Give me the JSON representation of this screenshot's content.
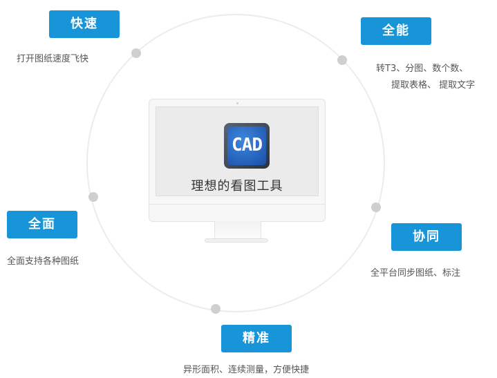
{
  "logo": {
    "text": "CAD"
  },
  "center": {
    "title": "理想的看图工具"
  },
  "features": {
    "fast": {
      "title": "快速",
      "desc": "打开图纸速度飞快"
    },
    "capable": {
      "title": "全能",
      "desc_lines": [
        "转T3、分图、数个数、",
        "提取表格、 提取文字"
      ]
    },
    "full": {
      "title": "全面",
      "desc": "全面支持各种图纸"
    },
    "collab": {
      "title": "协同",
      "desc": "全平台同步图纸、标注"
    },
    "precise": {
      "title": "精准",
      "desc": "异形面积、连续测量，方便快捷"
    }
  },
  "colors": {
    "accent": "#1795d8",
    "ring": "#ececec",
    "dot": "#cfcfcf"
  }
}
